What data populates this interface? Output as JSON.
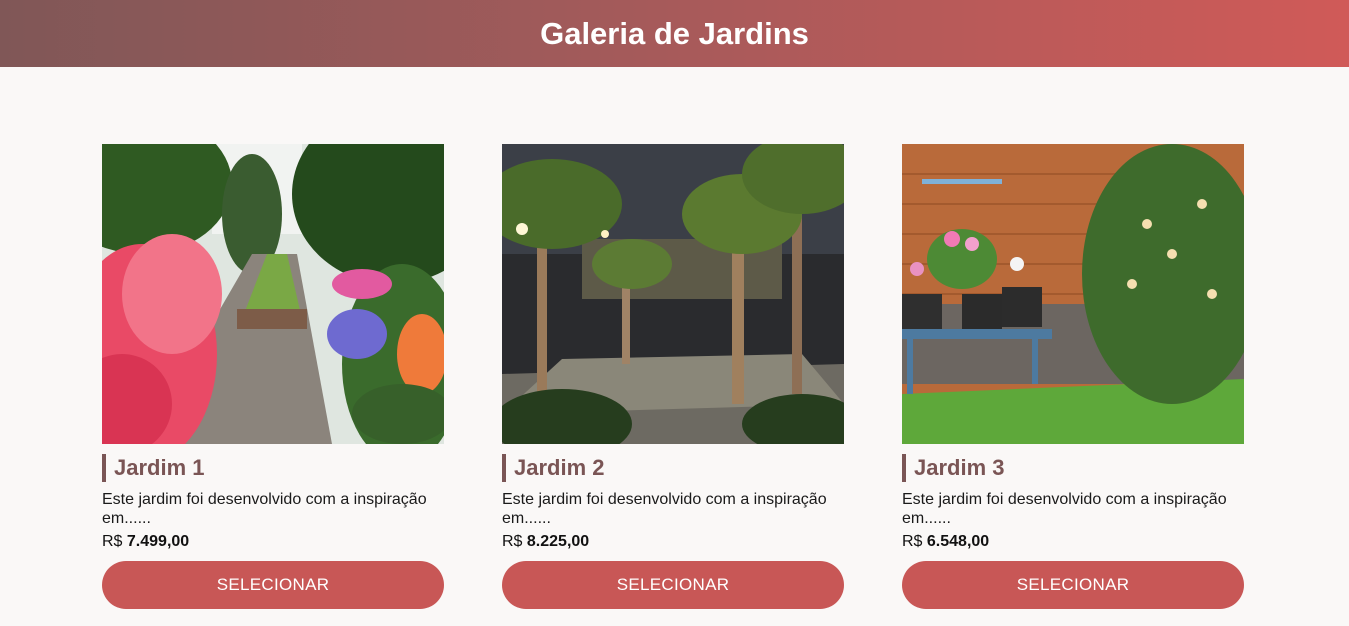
{
  "header": {
    "title": "Galeria de Jardins"
  },
  "currency": "R$",
  "cards": [
    {
      "title": "Jardim 1",
      "description": "Este jardim foi desenvolvido com a inspiração em......",
      "price": "7.499,00",
      "button": "SELECIONAR",
      "image": "garden-path-azaleas"
    },
    {
      "title": "Jardim 2",
      "description": "Este jardim foi desenvolvido com a inspiração em......",
      "price": "8.225,00",
      "button": "SELECIONAR",
      "image": "palm-courtyard-night"
    },
    {
      "title": "Jardim 3",
      "description": "Este jardim foi desenvolvido com a inspiração em......",
      "price": "6.548,00",
      "button": "SELECIONAR",
      "image": "potted-flowers-cart"
    }
  ]
}
